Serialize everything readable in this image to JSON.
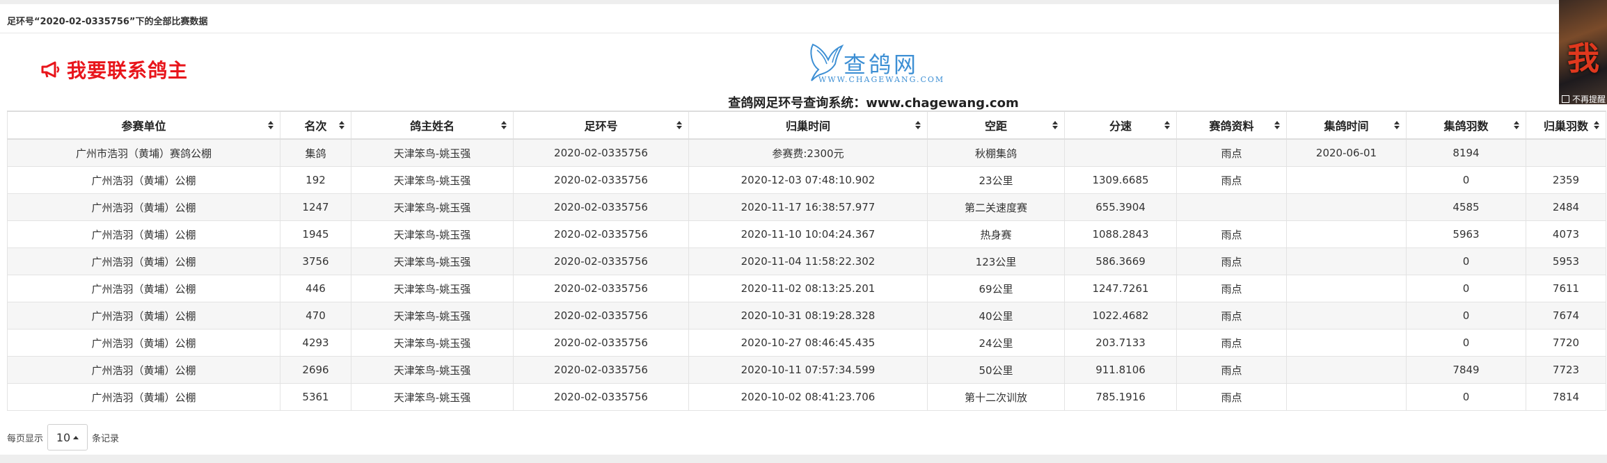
{
  "panel": {
    "title": "足环号“2020-02-0335756”下的全部比赛数据"
  },
  "contact": {
    "label": "我要联系鸽主",
    "icon": "megaphone-icon",
    "color": "#e8151b"
  },
  "logo": {
    "text": "查鸽网",
    "url": "WWW.CHAGEWANG.COM",
    "icon": "pigeon-icon",
    "color": "#3d8fd4"
  },
  "system_title": "查鸽网足环号查询系统：www.chagewang.com",
  "ad": {
    "glyph": "我",
    "close_label": "不再提醒"
  },
  "table": {
    "columns": [
      "参赛单位",
      "名次",
      "鸽主姓名",
      "足环号",
      "归巢时间",
      "空距",
      "分速",
      "赛鸽资料",
      "集鸽时间",
      "集鸽羽数",
      "归巢羽数"
    ],
    "rows": [
      [
        "广州市浩羽（黄埔）赛鸽公棚",
        "集鸽",
        "天津笨鸟-姚玉强",
        "2020-02-0335756",
        "参赛费:2300元",
        "秋棚集鸽",
        "",
        "雨点",
        "2020-06-01",
        "8194",
        ""
      ],
      [
        "广州浩羽（黄埔）公棚",
        "192",
        "天津笨鸟-姚玉强",
        "2020-02-0335756",
        "2020-12-03 07:48:10.902",
        "23公里",
        "1309.6685",
        "雨点",
        "",
        "0",
        "2359"
      ],
      [
        "广州浩羽（黄埔）公棚",
        "1247",
        "天津笨鸟-姚玉强",
        "2020-02-0335756",
        "2020-11-17 16:38:57.977",
        "第二关速度赛",
        "655.3904",
        "",
        "",
        "4585",
        "2484"
      ],
      [
        "广州浩羽（黄埔）公棚",
        "1945",
        "天津笨鸟-姚玉强",
        "2020-02-0335756",
        "2020-11-10 10:04:24.367",
        "热身赛",
        "1088.2843",
        "雨点",
        "",
        "5963",
        "4073"
      ],
      [
        "广州浩羽（黄埔）公棚",
        "3756",
        "天津笨鸟-姚玉强",
        "2020-02-0335756",
        "2020-11-04 11:58:22.302",
        "123公里",
        "586.3669",
        "雨点",
        "",
        "0",
        "5953"
      ],
      [
        "广州浩羽（黄埔）公棚",
        "446",
        "天津笨鸟-姚玉强",
        "2020-02-0335756",
        "2020-11-02 08:13:25.201",
        "69公里",
        "1247.7261",
        "雨点",
        "",
        "0",
        "7611"
      ],
      [
        "广州浩羽（黄埔）公棚",
        "470",
        "天津笨鸟-姚玉强",
        "2020-02-0335756",
        "2020-10-31 08:19:28.328",
        "40公里",
        "1022.4682",
        "雨点",
        "",
        "0",
        "7674"
      ],
      [
        "广州浩羽（黄埔）公棚",
        "4293",
        "天津笨鸟-姚玉强",
        "2020-02-0335756",
        "2020-10-27 08:46:45.435",
        "24公里",
        "203.7133",
        "雨点",
        "",
        "0",
        "7720"
      ],
      [
        "广州浩羽（黄埔）公棚",
        "2696",
        "天津笨鸟-姚玉强",
        "2020-02-0335756",
        "2020-10-11 07:57:34.599",
        "50公里",
        "911.8106",
        "雨点",
        "",
        "7849",
        "7723"
      ],
      [
        "广州浩羽（黄埔）公棚",
        "5361",
        "天津笨鸟-姚玉强",
        "2020-02-0335756",
        "2020-10-02 08:41:23.706",
        "第十二次训放",
        "785.1916",
        "雨点",
        "",
        "0",
        "7814"
      ]
    ]
  },
  "pager": {
    "prefix": "每页显示",
    "page_size": "10",
    "suffix": "条记录"
  }
}
